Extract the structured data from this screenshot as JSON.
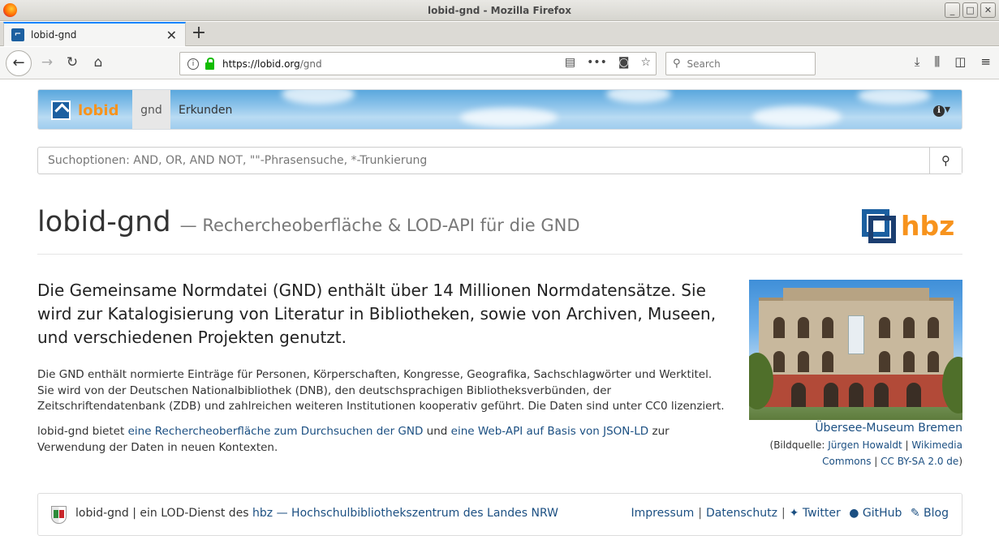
{
  "window": {
    "title": "lobid-gnd - Mozilla Firefox",
    "minimize": "_",
    "maximize": "□",
    "close": "✕"
  },
  "tab": {
    "label": "lobid-gnd",
    "close": "✕",
    "new_tab": "+"
  },
  "navbar": {
    "url_host": "https://lobid.org",
    "url_path": "/gnd",
    "search_placeholder": "Search"
  },
  "site_nav": {
    "brand": "lobid",
    "items": [
      {
        "label": "gnd"
      },
      {
        "label": "Erkunden"
      }
    ],
    "info_caret": "▾"
  },
  "search": {
    "placeholder": "Suchoptionen: AND, OR, AND NOT, \"\"-Phrasensuche, *-Trunkierung"
  },
  "heading": {
    "title": "lobid-gnd",
    "subtitle": "— Rechercheoberfläche & LOD-API für die GND"
  },
  "hbz_logo": "hbz",
  "lead": "Die Gemeinsame Normdatei (GND) enthält über 14 Millionen Normdatensätze. Sie wird zur Katalogisierung von Literatur in Bibliotheken, sowie von Archiven, Museen, und verschiedenen Projekten genutzt.",
  "para1": "Die GND enthält normierte Einträge für Personen, Körperschaften, Kongresse, Geografika, Sachschlagwörter und Werktitel. Sie wird von der Deutschen Nationalbibliothek (DNB), den deutschsprachigen Bibliotheksverbünden, der Zeitschriftendatenbank (ZDB) und zahlreichen weiteren Institutionen kooperativ geführt. Die Daten sind unter CC0 lizenziert.",
  "para2": {
    "t1": "lobid-gnd bietet ",
    "link1": "eine Rechercheoberfläche zum Durchsuchen der GND",
    "t2": " und ",
    "link2": "eine Web-API auf Basis von JSON-LD",
    "t3": " zur Verwendung der Daten in neuen Kontexten."
  },
  "photo": {
    "caption": "Übersee-Museum Bremen",
    "credit_prefix": "(Bildquelle: ",
    "author": "Jürgen Howaldt",
    "sep": " | ",
    "source": "Wikimedia Commons",
    "license": "CC BY-SA 2.0 de",
    "credit_suffix": ")"
  },
  "footer": {
    "left_text": "lobid-gnd | ein LOD-Dienst des ",
    "left_link": "hbz — Hochschulbibliothekszentrum des Landes NRW",
    "impressum": "Impressum",
    "datenschutz": "Datenschutz",
    "twitter": "Twitter",
    "github": "GitHub",
    "blog": "Blog",
    "sep": "|"
  }
}
